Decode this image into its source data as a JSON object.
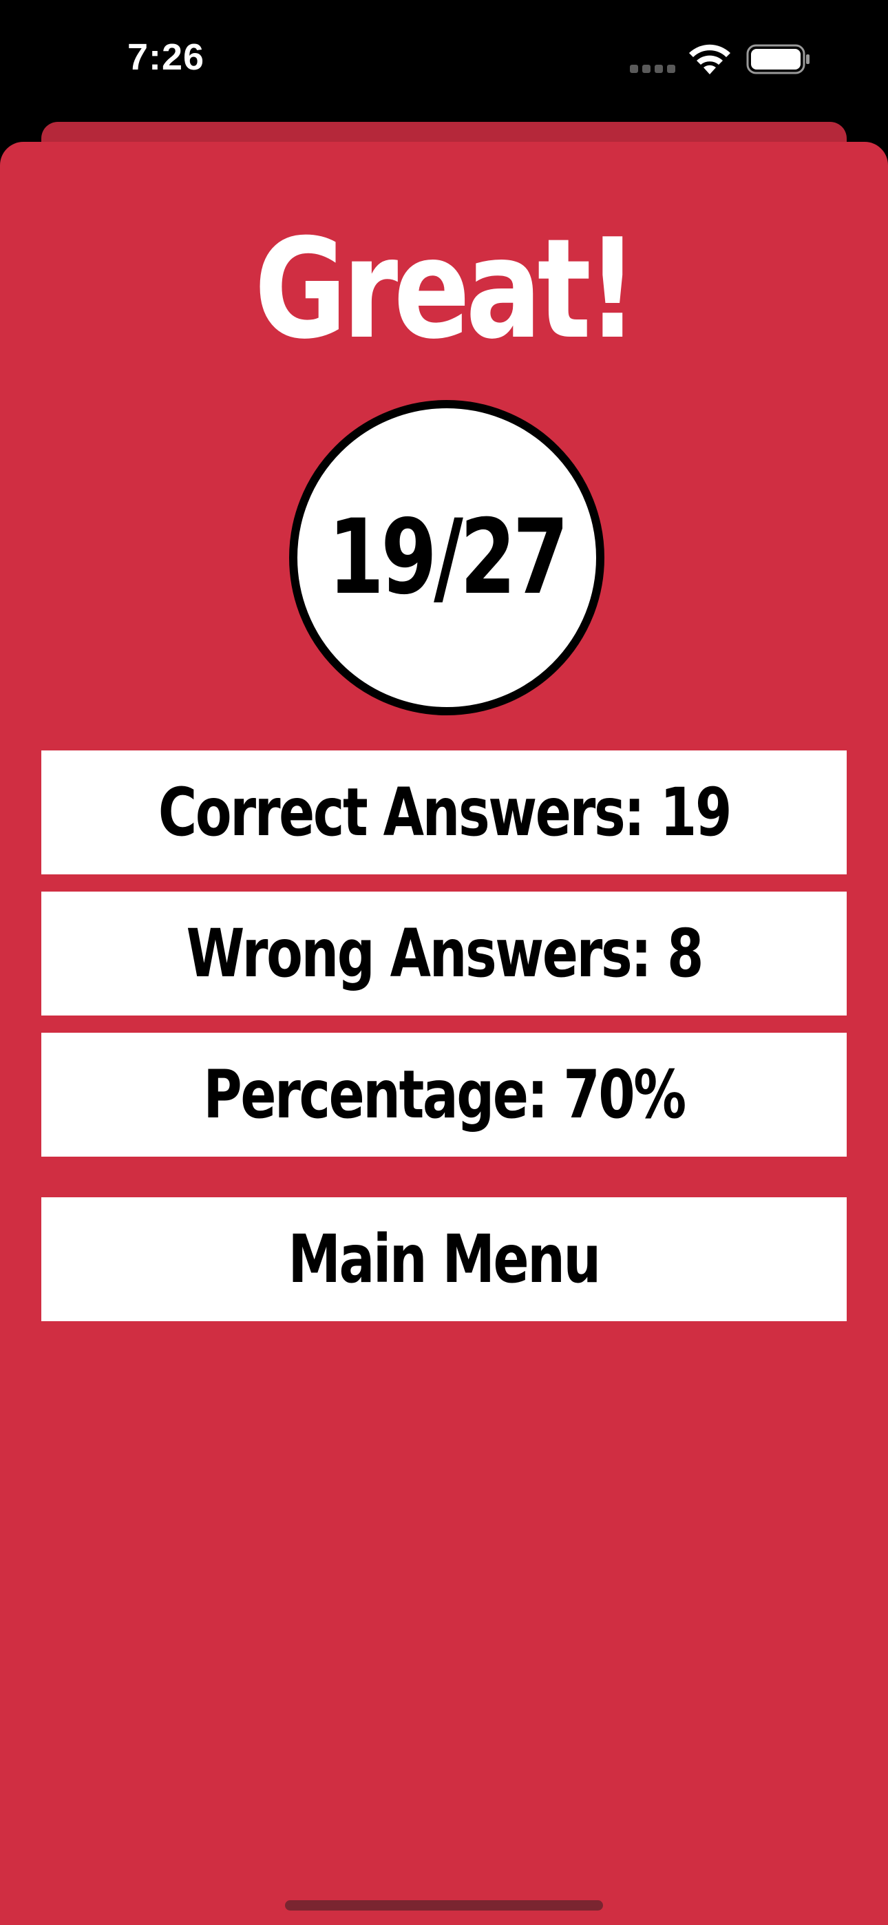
{
  "status_bar": {
    "time": "7:26",
    "icons": [
      "cellular-signal-icon",
      "wifi-icon",
      "battery-icon"
    ]
  },
  "result": {
    "title": "Great!",
    "score": "19/27",
    "correct_label": "Correct Answers: 19",
    "wrong_label": "Wrong Answers: 8",
    "percentage_label": "Percentage: 70%"
  },
  "actions": {
    "main_menu_label": "Main Menu"
  },
  "colors": {
    "card_background": "#d02e42",
    "back_sheet": "#b5283a",
    "box_background": "#ffffff",
    "title_text": "#ffffff",
    "box_text": "#000000"
  }
}
